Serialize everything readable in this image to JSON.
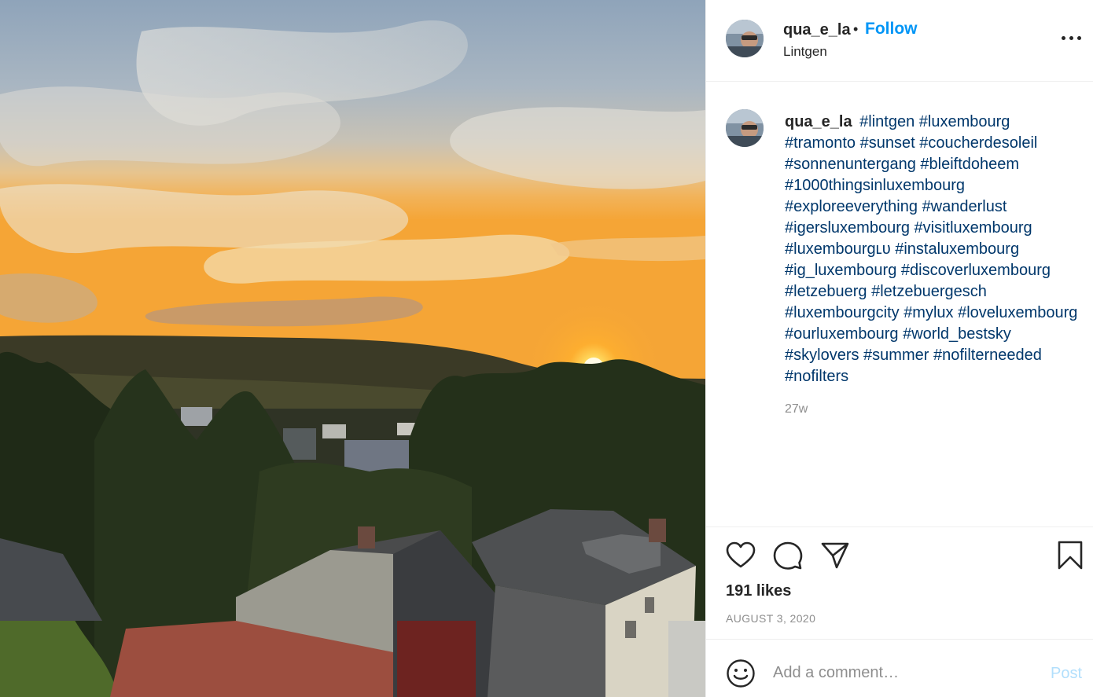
{
  "photo": {
    "alt": ""
  },
  "post": {
    "username": "qua_e_la",
    "separator": "•",
    "follow_label": "Follow",
    "location": "Lintgen",
    "hashtags": [
      "#lintgen",
      "#luxembourg",
      "#tramonto",
      "#sunset",
      "#coucherdesoleil",
      "#sonnenuntergang",
      "#bleiftdoheem",
      "#1000thingsinluxembourg",
      "#exploreeverything",
      "#wanderlust",
      "#igersluxembourg",
      "#visitluxembourg",
      "#luxembourgʟᴜ",
      "#instaluxembourg",
      "#ig_luxembourg",
      "#discoverluxembourg",
      "#letzebuerg",
      "#letzebuergesch",
      "#luxembourgcity",
      "#mylux",
      "#loveluxembourg",
      "#ourluxembourg",
      "#world_bestsky",
      "#skylovers",
      "#summer",
      "#nofilterneeded",
      "#nofilters"
    ],
    "age": "27w",
    "likes": "191 likes",
    "date": "AUGUST 3, 2020"
  },
  "comment": {
    "placeholder": "Add a comment…",
    "post_label": "Post"
  },
  "icons": {
    "more": "more-options-icon",
    "like": "heart-icon",
    "comment": "comment-icon",
    "share": "paper-plane-icon",
    "save": "bookmark-icon",
    "emoji": "smiley-icon"
  },
  "colors": {
    "link": "#0095f6",
    "hashtag": "#00376b",
    "muted": "#8e8e8e",
    "post_disabled": "#b2dffc"
  }
}
